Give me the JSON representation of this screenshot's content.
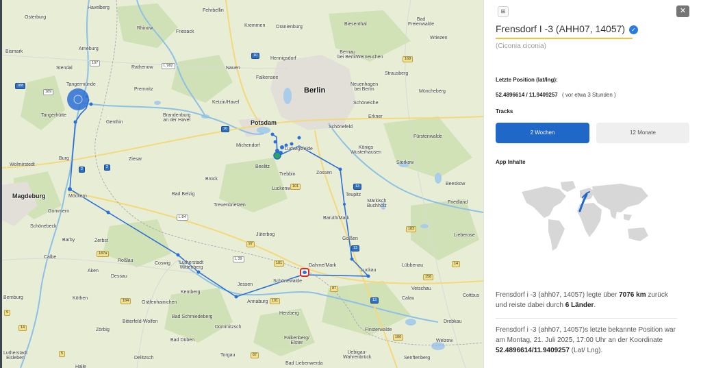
{
  "map": {
    "cities": [
      {
        "name": "Berlin"
      },
      {
        "name": "Magdeburg"
      },
      {
        "name": "Potsdam"
      },
      {
        "name": "Havelberg"
      },
      {
        "name": "Fehrbellin"
      },
      {
        "name": "Oranienburg"
      },
      {
        "name": "Kremmen"
      },
      {
        "name": "Biesenthal"
      },
      {
        "name": "Bad Freienwalde"
      },
      {
        "name": "Osterburg"
      },
      {
        "name": "Rhinow"
      },
      {
        "name": "Friesack"
      },
      {
        "name": "Bernau bei Berlin"
      },
      {
        "name": "Wriezen"
      },
      {
        "name": "Bismark"
      },
      {
        "name": "Arneburg"
      },
      {
        "name": "Hennigsdorf"
      },
      {
        "name": "Werneuchen"
      },
      {
        "name": "Stendal"
      },
      {
        "name": "Rathenow"
      },
      {
        "name": "Nauen"
      },
      {
        "name": "Falkensee"
      },
      {
        "name": "Strausberg"
      },
      {
        "name": "Tangermünde"
      },
      {
        "name": "Premnitz"
      },
      {
        "name": "Neuenhagen bei Berlin"
      },
      {
        "name": "Müncheberg"
      },
      {
        "name": "Tangerhütte"
      },
      {
        "name": "Ketzin/Havel"
      },
      {
        "name": "Schöneiche"
      },
      {
        "name": "Genthin"
      },
      {
        "name": "Brandenburg an der Havel"
      },
      {
        "name": "Schönefeld"
      },
      {
        "name": "Erkner"
      },
      {
        "name": "Fürstenwalde"
      },
      {
        "name": "Michendorf"
      },
      {
        "name": "Ludwigsfelde"
      },
      {
        "name": "Königs Wusterhausen"
      },
      {
        "name": "Wolmirstedt"
      },
      {
        "name": "Burg"
      },
      {
        "name": "Ziesar"
      },
      {
        "name": "Beelitz"
      },
      {
        "name": "Storkow"
      },
      {
        "name": "Zossen"
      },
      {
        "name": "Trebbin"
      },
      {
        "name": "Beeskow"
      },
      {
        "name": "Möckern"
      },
      {
        "name": "Brück"
      },
      {
        "name": "Bad Belzig"
      },
      {
        "name": "Teupitz"
      },
      {
        "name": "Märkisch Buchholz"
      },
      {
        "name": "Friedland"
      },
      {
        "name": "Gommern"
      },
      {
        "name": "Treuenbrietzen"
      },
      {
        "name": "Luckenwalde"
      },
      {
        "name": "Schönebeck"
      },
      {
        "name": "Baruth/Mark"
      },
      {
        "name": "Lieberose"
      },
      {
        "name": "Barby"
      },
      {
        "name": "Zerbst"
      },
      {
        "name": "Jüterbog"
      },
      {
        "name": "Golßen"
      },
      {
        "name": "Calbe"
      },
      {
        "name": "Roßlau"
      },
      {
        "name": "Coswig"
      },
      {
        "name": "Lutherstadt Wittenberg"
      },
      {
        "name": "Dahme/Mark"
      },
      {
        "name": "Luckau"
      },
      {
        "name": "Lübbenau"
      },
      {
        "name": "Aken"
      },
      {
        "name": "Dessau"
      },
      {
        "name": "Jessen"
      },
      {
        "name": "Schönewalde"
      },
      {
        "name": "Vetschau"
      },
      {
        "name": "Cottbus"
      },
      {
        "name": "Bernburg"
      },
      {
        "name": "Köthen"
      },
      {
        "name": "Kemberg"
      },
      {
        "name": "Annaburg"
      },
      {
        "name": "Calau"
      },
      {
        "name": "Gräfenhainichen"
      },
      {
        "name": "Bad Schmiedeberg"
      },
      {
        "name": "Herzberg"
      },
      {
        "name": "Drebkau"
      },
      {
        "name": "Bitterfeld-Wolfen"
      },
      {
        "name": "Zörbig"
      },
      {
        "name": "Dommitzsch"
      },
      {
        "name": "Finsterwalde"
      },
      {
        "name": "Bad Düben"
      },
      {
        "name": "Falkenberg/Elster"
      },
      {
        "name": "Welzow"
      },
      {
        "name": "Lutherstadt Eisleben"
      },
      {
        "name": "Delitzsch"
      },
      {
        "name": "Torgau"
      },
      {
        "name": "Uebigau-Wahrenbrück"
      },
      {
        "name": "Senftenberg"
      },
      {
        "name": "Bad Liebenwerda"
      },
      {
        "name": "Halle"
      }
    ],
    "shields": [
      {
        "text": "107"
      },
      {
        "text": "188"
      },
      {
        "text": "189"
      },
      {
        "text": "L 982"
      },
      {
        "text": "10"
      },
      {
        "text": "10"
      },
      {
        "text": "2"
      },
      {
        "text": "2"
      },
      {
        "text": "101"
      },
      {
        "text": "13"
      },
      {
        "text": "L 84"
      },
      {
        "text": "L 39"
      },
      {
        "text": "101"
      },
      {
        "text": "13"
      },
      {
        "text": "187a"
      },
      {
        "text": "87"
      },
      {
        "text": "184"
      },
      {
        "text": "13"
      },
      {
        "text": "101"
      },
      {
        "text": "87"
      },
      {
        "text": "100"
      },
      {
        "text": "183"
      },
      {
        "text": "9"
      },
      {
        "text": "14"
      },
      {
        "text": "158"
      },
      {
        "text": "168"
      },
      {
        "text": "5"
      },
      {
        "text": "14"
      },
      {
        "text": "97"
      }
    ]
  },
  "panel": {
    "square_icon": "⊞",
    "close_label": "✕",
    "title": "Frensdorf I -3 (AHH07, 14057)",
    "verified_icon": "✓",
    "subtitle": "(Ciconia ciconia)",
    "last_position_label": "Letzte Position (lat/lng):",
    "coords": "52.4896614 / 11.9409257",
    "coords_ago": "( vor etwa 3 Stunden )",
    "tracks_label": "Tracks",
    "tabs": [
      "2 Wochen",
      "12 Monate"
    ],
    "app_content_label": "App Inhalte",
    "summary": {
      "p1_a": "Frensdorf i -3 (ahh07, 14057) legte über ",
      "p1_km": "7076 km",
      "p1_b": " zurück und reiste dabei durch ",
      "p1_countries": "6 Länder",
      "p1_c": ".",
      "p2_a": "Frensdorf i -3 (ahh07, 14057)s letzte bekannte Position war am Montag, 21. Juli 2025, 17:00 Uhr an der Koordinate ",
      "p2_coord": "52.4896614/11.9409257",
      "p2_b": " (Lat/ Lng)."
    }
  },
  "colors": {
    "accent": "#1f68c8",
    "track": "#2b6fd6",
    "title_underline": "#f3c13a",
    "highlight": "#e0242b"
  }
}
